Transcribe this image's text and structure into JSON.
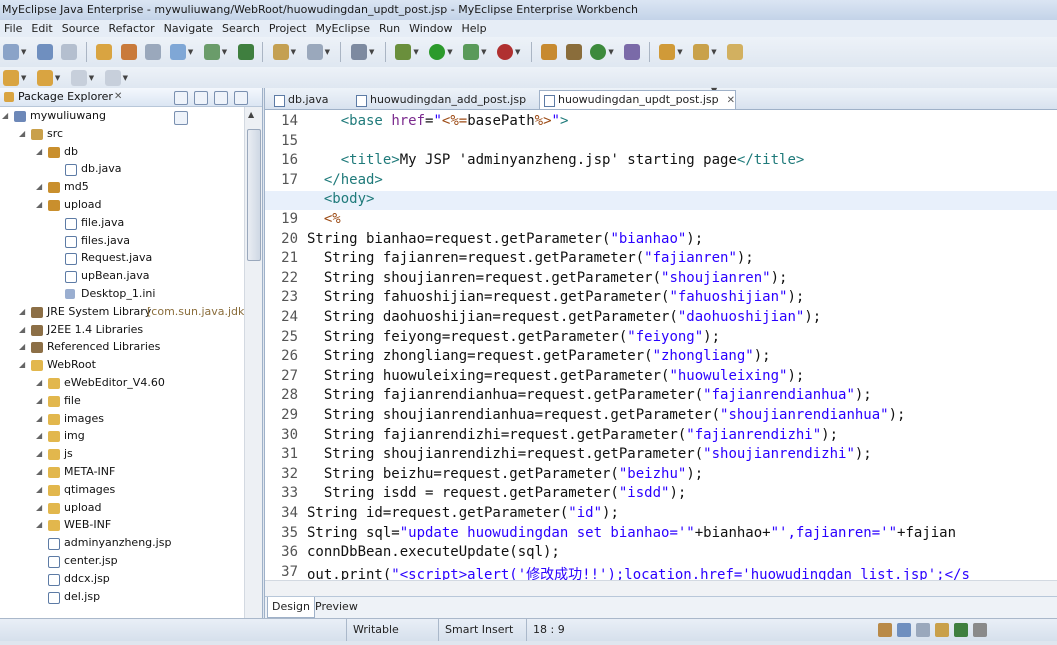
{
  "window": {
    "title": "MyEclipse Java Enterprise - mywuliuwang/WebRoot/huowudingdan_updt_post.jsp - MyEclipse Enterprise Workbench"
  },
  "menu": [
    "File",
    "Edit",
    "Source",
    "Refactor",
    "Navigate",
    "Search",
    "Project",
    "MyEclipse",
    "Run",
    "Window",
    "Help"
  ],
  "package_explorer": {
    "title": "Package Explorer",
    "close": "✕",
    "tree": [
      {
        "label": "mywuliuwang",
        "depth": 0,
        "icon": "project-icon"
      },
      {
        "label": "src",
        "depth": 1,
        "icon": "source-folder-icon"
      },
      {
        "label": "db",
        "depth": 2,
        "icon": "package-icon"
      },
      {
        "label": "db.java",
        "depth": 3,
        "icon": "java-file-icon"
      },
      {
        "label": "md5",
        "depth": 2,
        "icon": "package-icon"
      },
      {
        "label": "upload",
        "depth": 2,
        "icon": "package-icon"
      },
      {
        "label": "file.java",
        "depth": 3,
        "icon": "java-file-icon"
      },
      {
        "label": "files.java",
        "depth": 3,
        "icon": "java-file-icon"
      },
      {
        "label": "Request.java",
        "depth": 3,
        "icon": "java-file-icon"
      },
      {
        "label": "upBean.java",
        "depth": 3,
        "icon": "java-file-icon"
      },
      {
        "label": "Desktop_1.ini",
        "depth": 3,
        "icon": "ini-file-icon"
      },
      {
        "label": "JRE System Library",
        "depth": 1,
        "icon": "library-icon",
        "extra": "[com.sun.java.jdk."
      },
      {
        "label": "J2EE 1.4 Libraries",
        "depth": 1,
        "icon": "library-icon"
      },
      {
        "label": "Referenced Libraries",
        "depth": 1,
        "icon": "library-icon"
      },
      {
        "label": "WebRoot",
        "depth": 1,
        "icon": "folder-icon"
      },
      {
        "label": "eWebEditor_V4.60",
        "depth": 2,
        "icon": "folder-icon"
      },
      {
        "label": "file",
        "depth": 2,
        "icon": "folder-icon"
      },
      {
        "label": "images",
        "depth": 2,
        "icon": "folder-icon"
      },
      {
        "label": "img",
        "depth": 2,
        "icon": "folder-icon"
      },
      {
        "label": "js",
        "depth": 2,
        "icon": "folder-icon"
      },
      {
        "label": "META-INF",
        "depth": 2,
        "icon": "folder-icon"
      },
      {
        "label": "qtimages",
        "depth": 2,
        "icon": "folder-icon"
      },
      {
        "label": "upload",
        "depth": 2,
        "icon": "folder-icon"
      },
      {
        "label": "WEB-INF",
        "depth": 2,
        "icon": "folder-icon"
      },
      {
        "label": "adminyanzheng.jsp",
        "depth": 2,
        "icon": "jsp-file-icon"
      },
      {
        "label": "center.jsp",
        "depth": 2,
        "icon": "jsp-file-icon"
      },
      {
        "label": "ddcx.jsp",
        "depth": 2,
        "icon": "jsp-file-icon"
      },
      {
        "label": "del.jsp",
        "depth": 2,
        "icon": "jsp-file-icon"
      }
    ]
  },
  "editor": {
    "tabs": [
      {
        "label": "db.java",
        "active": false
      },
      {
        "label": "huowudingdan_add_post.jsp",
        "active": false
      },
      {
        "label": "huowudingdan_updt_post.jsp",
        "active": true
      }
    ],
    "lines": [
      {
        "n": "14",
        "html": "    <span class='tag'>&lt;base</span> <span class='attr'>href</span>=<span class='str'>\"</span><span class='jsp'>&lt;%=</span>basePath<span class='jsp'>%&gt;</span><span class='str'>\"</span><span class='tag'>&gt;</span>"
      },
      {
        "n": "15",
        "html": ""
      },
      {
        "n": "16",
        "html": "    <span class='tag'>&lt;title&gt;</span>My JSP 'adminyanzheng.jsp' starting page<span class='tag'>&lt;/title&gt;</span>"
      },
      {
        "n": "17",
        "html": "  <span class='tag'>&lt;/head&gt;</span>"
      },
      {
        "n": "18",
        "html": "  <span class='tag'>&lt;body&gt;</span>",
        "hl": true
      },
      {
        "n": "19",
        "html": "  <span class='jsp'>&lt;%</span>"
      },
      {
        "n": "20",
        "html": "String bianhao=request.getParameter(<span class='str'>\"bianhao\"</span>);"
      },
      {
        "n": "21",
        "html": "  String fajianren=request.getParameter(<span class='str'>\"fajianren\"</span>);"
      },
      {
        "n": "22",
        "html": "  String shoujianren=request.getParameter(<span class='str'>\"shoujianren\"</span>);"
      },
      {
        "n": "23",
        "html": "  String fahuoshijian=request.getParameter(<span class='str'>\"fahuoshijian\"</span>);"
      },
      {
        "n": "24",
        "html": "  String daohuoshijian=request.getParameter(<span class='str'>\"daohuoshijian\"</span>);"
      },
      {
        "n": "25",
        "html": "  String feiyong=request.getParameter(<span class='str'>\"feiyong\"</span>);"
      },
      {
        "n": "26",
        "html": "  String zhongliang=request.getParameter(<span class='str'>\"zhongliang\"</span>);"
      },
      {
        "n": "27",
        "html": "  String huowuleixing=request.getParameter(<span class='str'>\"huowuleixing\"</span>);"
      },
      {
        "n": "28",
        "html": "  String fajianrendianhua=request.getParameter(<span class='str'>\"fajianrendianhua\"</span>);"
      },
      {
        "n": "29",
        "html": "  String shoujianrendianhua=request.getParameter(<span class='str'>\"shoujianrendianhua\"</span>);"
      },
      {
        "n": "30",
        "html": "  String fajianrendizhi=request.getParameter(<span class='str'>\"fajianrendizhi\"</span>);"
      },
      {
        "n": "31",
        "html": "  String shoujianrendizhi=request.getParameter(<span class='str'>\"shoujianrendizhi\"</span>);"
      },
      {
        "n": "32",
        "html": "  String beizhu=request.getParameter(<span class='str'>\"beizhu\"</span>);"
      },
      {
        "n": "33",
        "html": "  String isdd = request.getParameter(<span class='str'>\"isdd\"</span>);"
      },
      {
        "n": "34",
        "html": "String id=request.getParameter(<span class='str'>\"id\"</span>);"
      },
      {
        "n": "35",
        "html": "String sql=<span class='str'>\"update huowudingdan set bianhao='\"</span>+bianhao+<span class='str'>\"',fajianren='\"</span>+fajian"
      },
      {
        "n": "36",
        "html": "connDbBean.executeUpdate(sql);"
      },
      {
        "n": "37",
        "html": "out.print(<span class='str'>\"&lt;script&gt;alert('修改成功!!');location.href='huowudingdan_list.jsp';&lt;/s</span>"
      }
    ],
    "bottom_tabs": [
      "Design",
      "Preview"
    ]
  },
  "status": {
    "mode": "Writable",
    "insert": "Smart Insert",
    "position": "18 : 9"
  }
}
